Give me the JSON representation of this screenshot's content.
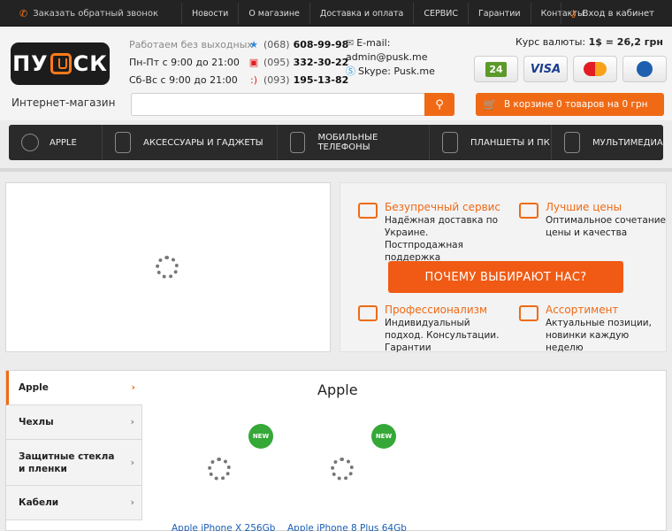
{
  "topbar": {
    "callback": "Заказать обратный звонок",
    "nav": [
      "Новости",
      "О магазине",
      "Доставка и оплата",
      "СЕРВИС",
      "Гарантии",
      "Контакты"
    ],
    "login": "Вход в кабинет"
  },
  "header": {
    "logo_text_left": "ПУ",
    "logo_text_right": "СК",
    "logo_sub": "Интернет-магазин",
    "hours_title": "Работаем без выходных",
    "hours": [
      "Пн-Пт с 9:00 до 21:00",
      "Сб-Вс с 9:00 до 21:00"
    ],
    "phones": [
      {
        "code": "(068)",
        "num": "608-99-98",
        "glyph": "★",
        "color": "#2e8ad8"
      },
      {
        "code": "(095)",
        "num": "332-30-22",
        "glyph": "▣",
        "color": "#e02020"
      },
      {
        "code": "(093)",
        "num": "195-13-82",
        "glyph": ":)",
        "color": "#e02020"
      }
    ],
    "email_label": "E-mail:",
    "email": "admin@pusk.me",
    "skype": "Skype: Pusk.me",
    "currency_label": "Курс валюты:",
    "currency_value": "1$ = 26,2 грн",
    "payments": [
      "24",
      "VISA",
      "MasterCard",
      "WebMoney"
    ],
    "cart_text": "В корзине 0 товаров на 0 грн"
  },
  "mainnav": [
    "APPLE",
    "АКСЕССУАРЫ И ГАДЖЕТЫ",
    "МОБИЛЬНЫЕ ТЕЛЕФОНЫ",
    "ПЛАНШЕТЫ И ПК",
    "МУЛЬТИМЕДИА"
  ],
  "benefits": {
    "items": [
      {
        "title": "Безупречный сервис",
        "text": "Надёжная доставка по Украине. Постпродажная поддержка"
      },
      {
        "title": "Лучшие цены",
        "text": "Оптимальное сочетание цены и качества"
      },
      {
        "title": "Профессионализм",
        "text": "Индивидуальный подход. Консультации. Гарантии"
      },
      {
        "title": "Ассортимент",
        "text": "Актуальные позиции, новинки каждую неделю"
      }
    ],
    "cta": "ПОЧЕМУ ВЫБИРАЮТ НАС?"
  },
  "catalog": {
    "side": [
      "Apple",
      "Чехлы",
      "Защитные стекла и пленки",
      "Кабели"
    ],
    "title": "Apple",
    "badge": "NEW",
    "products": [
      "Apple iPhone X 256Gb",
      "Apple iPhone 8 Plus 64Gb"
    ]
  }
}
